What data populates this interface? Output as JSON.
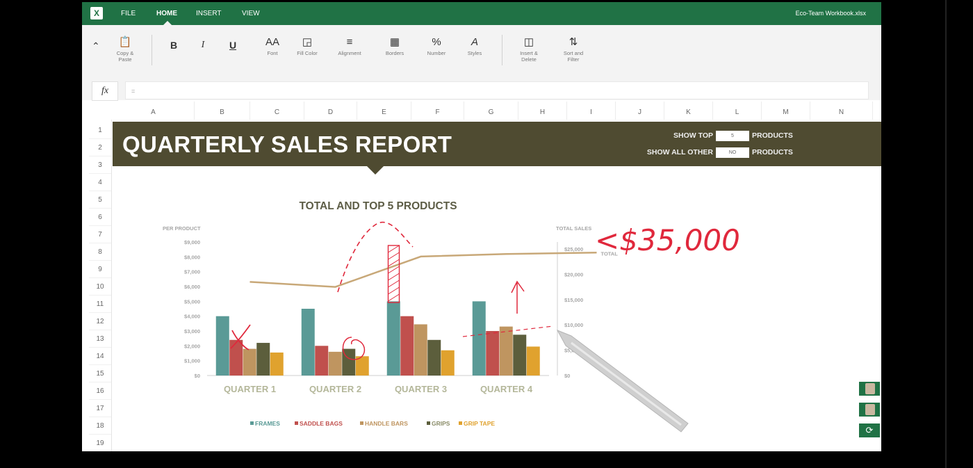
{
  "menubar": {
    "items": [
      {
        "label": "FILE",
        "active": false
      },
      {
        "label": "HOME",
        "active": true
      },
      {
        "label": "INSERT",
        "active": false
      },
      {
        "label": "VIEW",
        "active": false
      }
    ],
    "file_name": "Eco-Team Workbook.xlsx"
  },
  "ribbon": {
    "copy_paste": "Copy & Paste",
    "bold": "B",
    "italic": "I",
    "underline": "U",
    "font": "Font",
    "fill_color": "Fill Color",
    "alignment": "Alignment",
    "borders": "Borders",
    "number": "Number",
    "styles": "Styles",
    "insert_delete": "Insert & Delete",
    "sort_filter": "Sort and Filter"
  },
  "formula": {
    "fx": "fx",
    "value": "="
  },
  "columns": [
    "A",
    "B",
    "C",
    "D",
    "E",
    "F",
    "G",
    "H",
    "I",
    "J",
    "K",
    "L",
    "M",
    "N"
  ],
  "rows": [
    "1",
    "2",
    "3",
    "4",
    "5",
    "6",
    "7",
    "8",
    "9",
    "10",
    "11",
    "12",
    "13",
    "14",
    "15",
    "16",
    "17",
    "18",
    "19"
  ],
  "report": {
    "title": "QUARTERLY SALES REPORT",
    "show_top_label": "SHOW TOP",
    "show_top_value": "5",
    "show_all_other_label": "SHOW ALL OTHER",
    "show_all_other_value": "NO",
    "products_label": "PRODUCTS"
  },
  "chart_data": {
    "type": "bar",
    "title": "TOTAL AND TOP 5 PRODUCTS",
    "ylabel_left": "PER PRODUCT",
    "ylabel_right": "TOTAL SALES",
    "categories": [
      "QUARTER 1",
      "QUARTER 2",
      "QUARTER 3",
      "QUARTER 4"
    ],
    "series": [
      {
        "name": "FRAMES",
        "color": "#5a9a96",
        "values": [
          4000,
          4500,
          5000,
          5000
        ]
      },
      {
        "name": "SADDLE BAGS",
        "color": "#c0504d",
        "values": [
          2400,
          2000,
          4000,
          3000
        ]
      },
      {
        "name": "HANDLE BARS",
        "color": "#bf9560",
        "values": [
          1800,
          1600,
          3450,
          3300
        ]
      },
      {
        "name": "GRIPS",
        "color": "#5c5e3c",
        "values": [
          2200,
          1800,
          2400,
          2750
        ]
      },
      {
        "name": "GRIP TAPE",
        "color": "#e0a22e",
        "values": [
          1550,
          1300,
          1700,
          1950
        ]
      }
    ],
    "line": {
      "name": "TOTAL",
      "color": "#c8a878",
      "values": [
        18500,
        17500,
        23500,
        24000
      ]
    },
    "ylim_left": [
      0,
      9000
    ],
    "yticks_left": [
      "$0",
      "$1,000",
      "$2,000",
      "$3,000",
      "$4,000",
      "$5,000",
      "$6,000",
      "$7,000",
      "$8,000",
      "$9,000"
    ],
    "ylim_right": [
      0,
      25000
    ],
    "yticks_right": [
      "$0",
      "$5,000",
      "$10,000",
      "$15,000",
      "$20,000",
      "$25,000"
    ],
    "legend_position": "bottom",
    "handwritten_annotation": "<$35,000",
    "ink_color": "#e0283c"
  }
}
